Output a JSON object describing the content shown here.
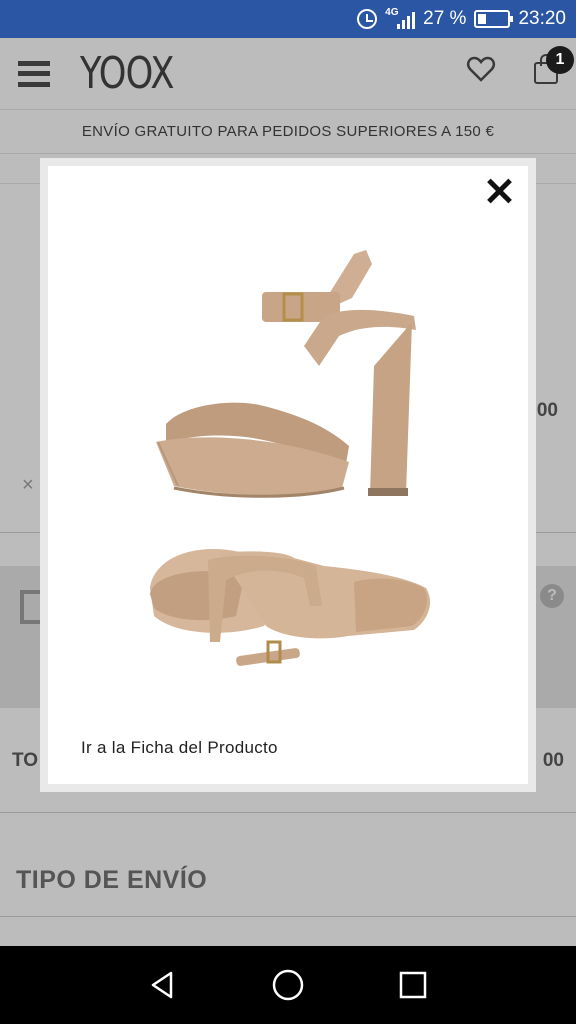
{
  "status_bar": {
    "network": "4G",
    "battery_percent": "27 %",
    "time": "23:20"
  },
  "header": {
    "logo": "YOOX",
    "cart_count": "1"
  },
  "banner": {
    "text": "ENVÍO GRATUITO PARA PEDIDOS SUPERIORES A 150 €"
  },
  "background": {
    "price_partial": "00",
    "total_partial": "TO",
    "total_price_partial": "00",
    "remove_glyph": "×",
    "help_glyph": "?",
    "section_title": "TIPO DE ENVÍO"
  },
  "modal": {
    "product_link": "Ir a la Ficha del Producto",
    "product_image": "beige-platform-sandal"
  },
  "colors": {
    "status_bar": "#2a56a4",
    "modal_bg": "#ffffff",
    "overlay": "#bdbdbd"
  },
  "icons": [
    "alarm-icon",
    "signal-icon",
    "battery-icon",
    "menu-icon",
    "heart-icon",
    "bag-icon",
    "close-icon",
    "back-icon",
    "home-icon",
    "recents-icon"
  ]
}
